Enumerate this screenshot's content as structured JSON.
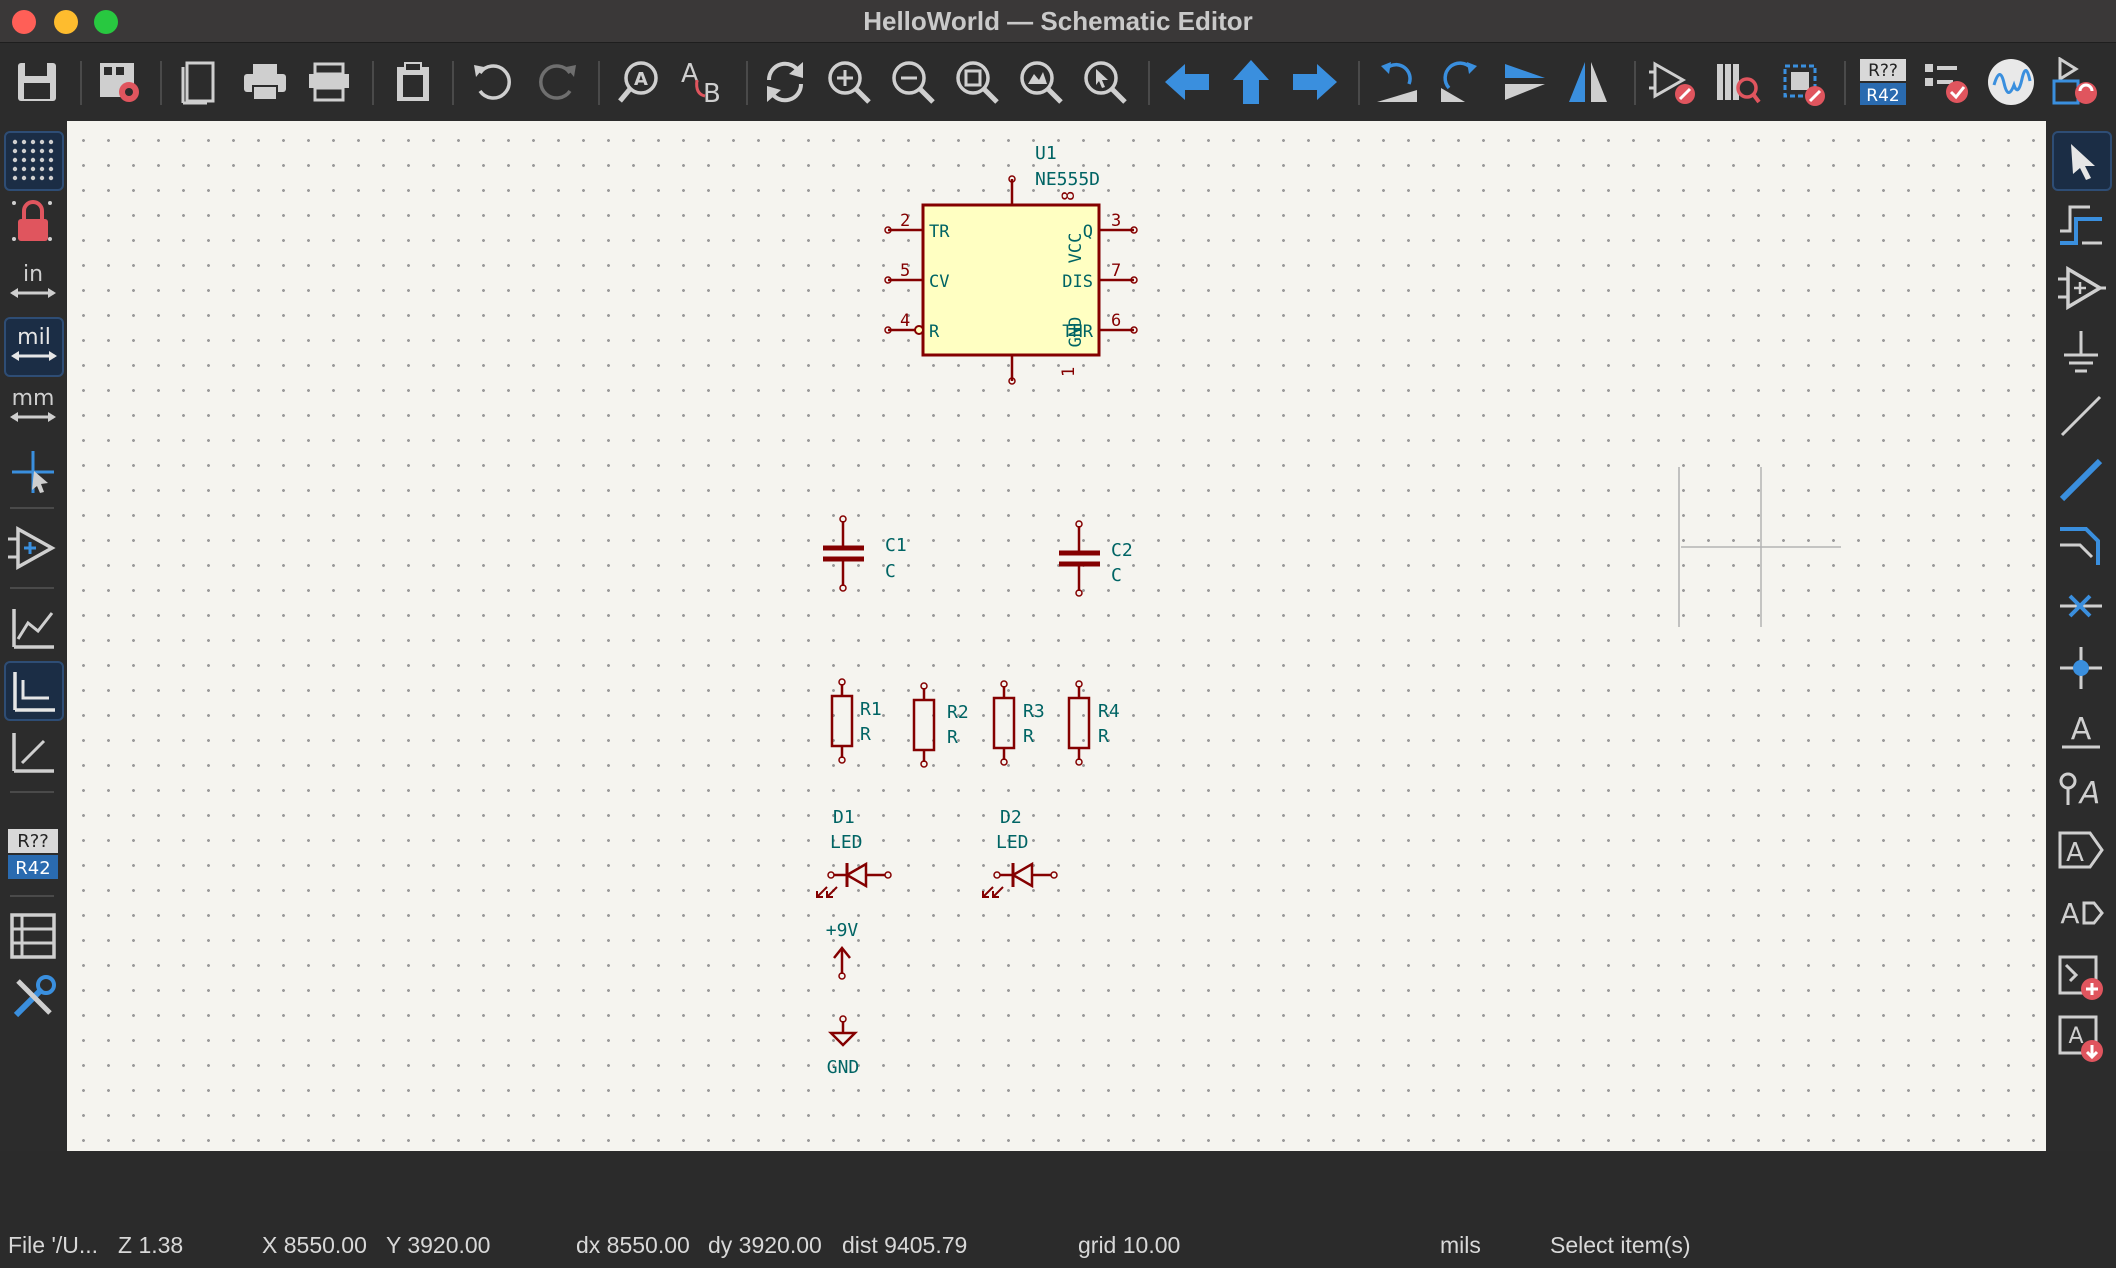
{
  "window": {
    "title": "HelloWorld — Schematic Editor",
    "traffic_lights": [
      "close",
      "minimize",
      "zoom"
    ]
  },
  "top_toolbar": [
    {
      "name": "save-icon"
    },
    {
      "name": "schematic-setup-icon"
    },
    {
      "name": "page-settings-icon"
    },
    {
      "name": "print-icon"
    },
    {
      "name": "plot-icon"
    },
    {
      "name": "paste-icon"
    },
    {
      "name": "undo-icon"
    },
    {
      "name": "redo-icon"
    },
    {
      "name": "find-icon"
    },
    {
      "name": "find-replace-icon"
    },
    {
      "name": "refresh-icon"
    },
    {
      "name": "zoom-in-icon"
    },
    {
      "name": "zoom-out-icon"
    },
    {
      "name": "zoom-fit-icon"
    },
    {
      "name": "zoom-objects-icon"
    },
    {
      "name": "zoom-selection-icon"
    },
    {
      "name": "navigate-back-icon"
    },
    {
      "name": "navigate-up-icon"
    },
    {
      "name": "navigate-forward-icon"
    },
    {
      "name": "rotate-ccw-icon"
    },
    {
      "name": "rotate-cw-icon"
    },
    {
      "name": "mirror-vertical-icon"
    },
    {
      "name": "mirror-horizontal-icon"
    },
    {
      "name": "symbol-editor-icon"
    },
    {
      "name": "symbol-browser-icon"
    },
    {
      "name": "footprint-editor-icon"
    },
    {
      "name": "annotate-icon",
      "label_top": "R??",
      "label_bottom": "R42"
    },
    {
      "name": "erc-icon"
    },
    {
      "name": "simulator-icon"
    },
    {
      "name": "update-pcb-icon"
    }
  ],
  "left_toolbar": [
    {
      "name": "grid-toggle-icon",
      "active": true
    },
    {
      "name": "grid-lock-icon"
    },
    {
      "name": "units-inches-icon",
      "label": "in"
    },
    {
      "name": "units-mils-icon",
      "label": "mil",
      "active": true
    },
    {
      "name": "units-mm-icon",
      "label": "mm"
    },
    {
      "name": "full-crosshair-icon"
    },
    {
      "name": "hidden-pins-icon"
    },
    {
      "name": "line-mode-free-icon"
    },
    {
      "name": "line-mode-90-icon",
      "active": true
    },
    {
      "name": "line-mode-45-icon"
    },
    {
      "name": "annotation-visibility-icon",
      "label_top": "R??",
      "label_bottom": "R42"
    },
    {
      "name": "hierarchy-navigator-icon"
    },
    {
      "name": "properties-tools-icon"
    }
  ],
  "right_toolbar": [
    {
      "name": "select-tool-icon",
      "active": true
    },
    {
      "name": "highlight-net-icon"
    },
    {
      "name": "add-symbol-icon"
    },
    {
      "name": "add-power-icon"
    },
    {
      "name": "add-wire-icon"
    },
    {
      "name": "add-bus-icon"
    },
    {
      "name": "bus-entry-icon"
    },
    {
      "name": "no-connect-icon"
    },
    {
      "name": "add-junction-icon"
    },
    {
      "name": "add-label-icon",
      "label": "A"
    },
    {
      "name": "add-net-class-icon",
      "label": "A"
    },
    {
      "name": "add-global-label-icon",
      "label": "A"
    },
    {
      "name": "add-hier-label-icon",
      "label": "A"
    },
    {
      "name": "add-sheet-icon"
    },
    {
      "name": "import-sheet-pin-icon",
      "label": "A"
    }
  ],
  "schematic": {
    "u1": {
      "ref": "U1",
      "value": "NE555D",
      "pins_left": [
        {
          "num": "2",
          "name": "TR"
        },
        {
          "num": "5",
          "name": "CV"
        },
        {
          "num": "4",
          "name": "R"
        }
      ],
      "pins_right": [
        {
          "num": "3",
          "name": "Q"
        },
        {
          "num": "7",
          "name": "DIS"
        },
        {
          "num": "6",
          "name": "THR"
        }
      ],
      "pin_top": {
        "num": "8",
        "name": "VCC"
      },
      "pin_bottom": {
        "num": "1",
        "name": "GND"
      }
    },
    "capacitors": [
      {
        "ref": "C1",
        "value": "C"
      },
      {
        "ref": "C2",
        "value": "C"
      }
    ],
    "resistors": [
      {
        "ref": "R1",
        "value": "R"
      },
      {
        "ref": "R2",
        "value": "R"
      },
      {
        "ref": "R3",
        "value": "R"
      },
      {
        "ref": "R4",
        "value": "R"
      }
    ],
    "leds": [
      {
        "ref": "D1",
        "value": "LED"
      },
      {
        "ref": "D2",
        "value": "LED"
      }
    ],
    "power": {
      "label": "+9V"
    },
    "ground": {
      "label": "GND"
    }
  },
  "colors": {
    "canvas_bg": "#f5f4ef",
    "grid_dot": "#9a9a9a",
    "symbol_body_stroke": "#840000",
    "symbol_body_fill": "#ffffc2",
    "pin_color": "#840000",
    "field_text": "#006464",
    "toolbar_blue": "#3a8fde",
    "close_red": "#ff5f57",
    "minimize_yellow": "#febc2e",
    "zoom_green": "#28c840"
  },
  "status": {
    "file": "File '/U...",
    "zoom": "Z 1.38",
    "x": "X 8550.00",
    "y": "Y 3920.00",
    "dx": "dx 8550.00",
    "dy": "dy 3920.00",
    "dist": "dist 9405.79",
    "grid": "grid 10.00",
    "units": "mils",
    "message": "Select item(s)"
  }
}
